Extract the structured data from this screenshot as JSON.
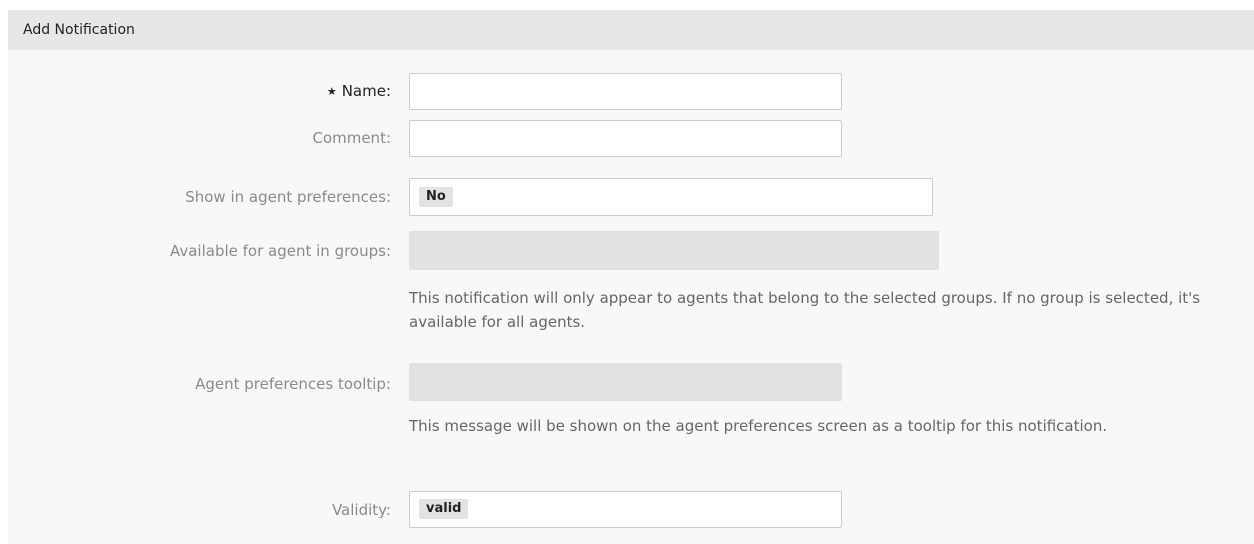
{
  "panel": {
    "title": "Add Notification"
  },
  "form": {
    "name": {
      "label": "Name:",
      "value": ""
    },
    "comment": {
      "label": "Comment:",
      "value": ""
    },
    "show_in_agent_preferences": {
      "label": "Show in agent preferences:",
      "selected": "No"
    },
    "available_for_agent_in_groups": {
      "label": "Available for agent in groups:",
      "help": "This notification will only appear to agents that belong to the selected groups. If no group is selected, it's available for all agents."
    },
    "agent_preferences_tooltip": {
      "label": "Agent preferences tooltip:",
      "value": "",
      "help": "This message will be shown on the agent preferences screen as a tooltip for this notification."
    },
    "validity": {
      "label": "Validity:",
      "selected": "valid"
    }
  },
  "icons": {
    "required": "required-star-icon",
    "required_glyph": "★"
  },
  "colors": {
    "header_bg": "#e7e7e7",
    "panel_bg": "#f8f8f8",
    "disabled_field": "#e2e2e2",
    "chip_bg": "#e3e3e3"
  }
}
